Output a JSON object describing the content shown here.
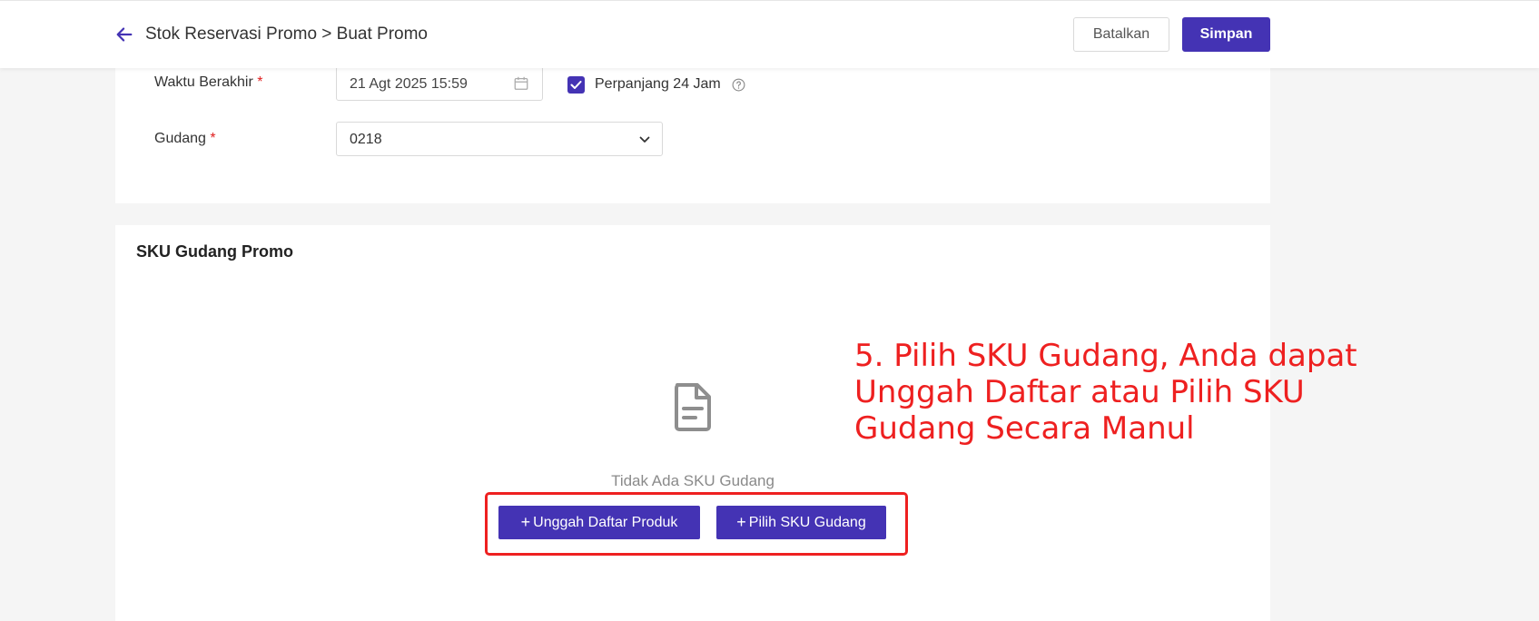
{
  "header": {
    "breadcrumb": "Stok Reservasi Promo > Buat Promo",
    "cancel_label": "Batalkan",
    "save_label": "Simpan"
  },
  "form": {
    "end_time": {
      "label": "Waktu Berakhir",
      "required_mark": "*",
      "value": "21 Agt 2025 15:59",
      "extend_label": "Perpanjang 24 Jam",
      "extend_checked": true
    },
    "warehouse": {
      "label": "Gudang",
      "required_mark": "*",
      "value": "0218"
    }
  },
  "sku_section": {
    "title": "SKU Gudang Promo",
    "empty_text": "Tidak Ada SKU Gudang",
    "upload_button": "Unggah Daftar Produk",
    "choose_button": "Pilih SKU Gudang",
    "plus_glyph": "+"
  },
  "annotation": {
    "text": "5. Pilih SKU Gudang, Anda dapat Unggah Daftar atau Pilih SKU Gudang Secara Manul"
  },
  "colors": {
    "accent": "#4433b4",
    "annotation": "#ee2020",
    "required": "#e02020"
  }
}
